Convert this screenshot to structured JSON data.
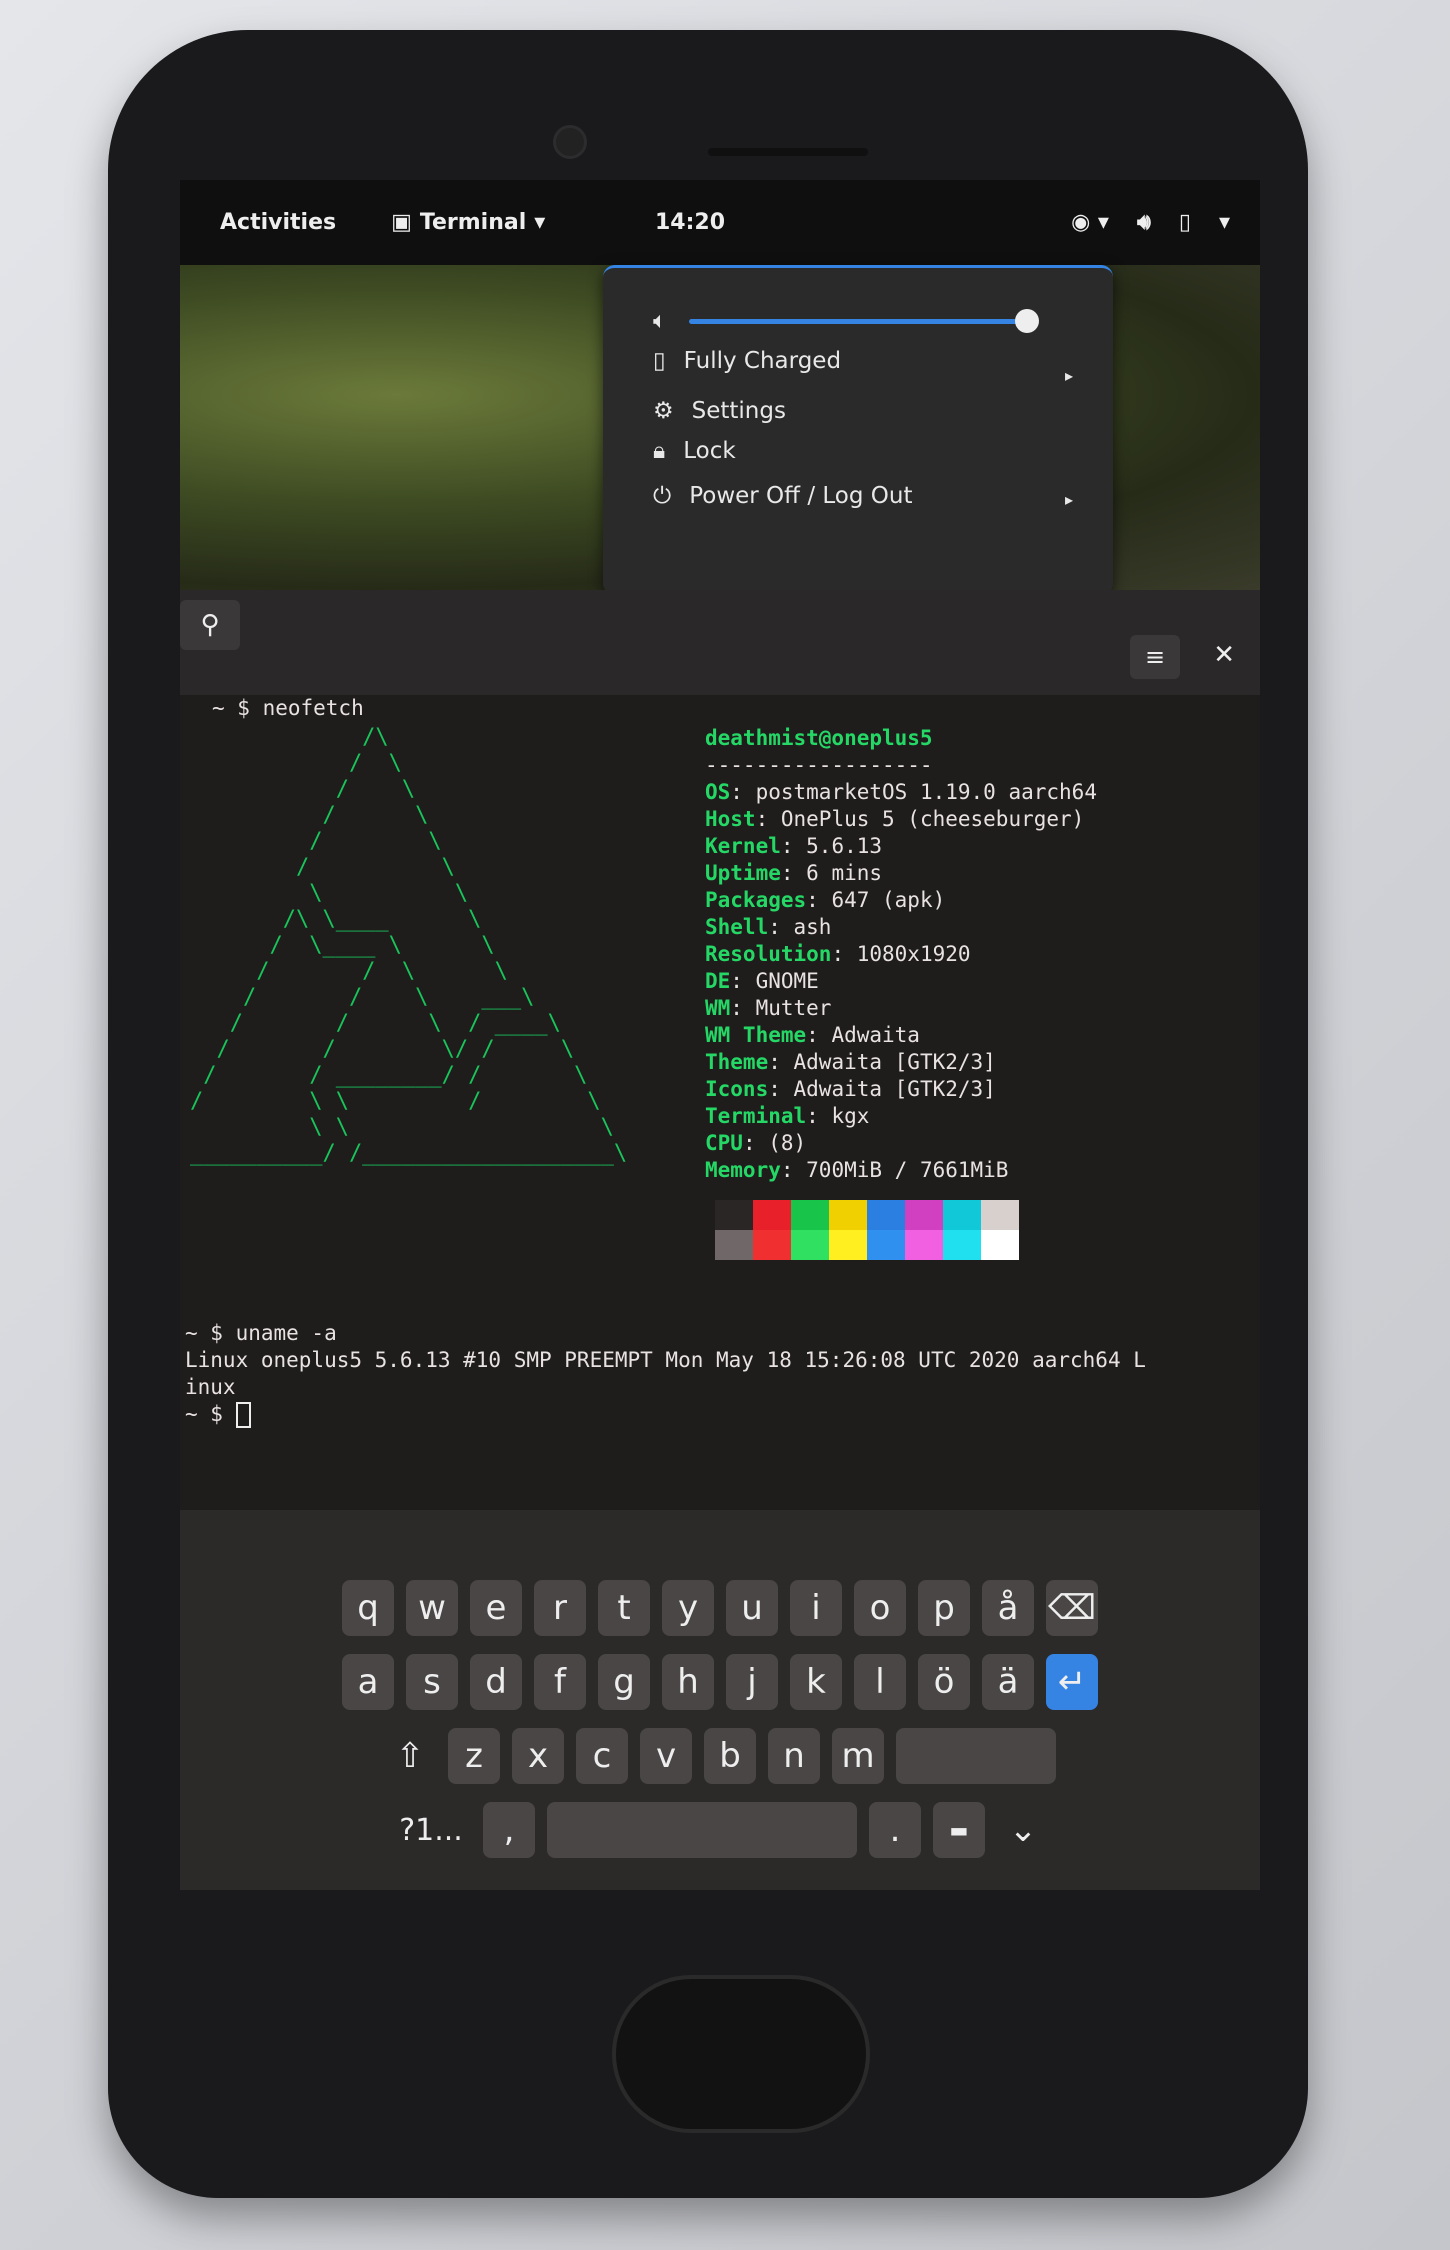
{
  "topbar": {
    "activities": "Activities",
    "app_name": "Terminal",
    "clock": "14:20"
  },
  "system_menu": {
    "battery_label": "Fully Charged",
    "settings_label": "Settings",
    "lock_label": "Lock",
    "power_label": "Power Off / Log Out",
    "volume_level": 0.95,
    "accent": "#3584e4"
  },
  "terminal": {
    "prompt1": "~ $ neofetch",
    "user_host": "deathmist@oneplus5",
    "separator": "------------------",
    "info": [
      {
        "k": "OS",
        "v": "postmarketOS 1.19.0 aarch64"
      },
      {
        "k": "Host",
        "v": "OnePlus 5 (cheeseburger)"
      },
      {
        "k": "Kernel",
        "v": "5.6.13"
      },
      {
        "k": "Uptime",
        "v": "6 mins"
      },
      {
        "k": "Packages",
        "v": "647 (apk)"
      },
      {
        "k": "Shell",
        "v": "ash"
      },
      {
        "k": "Resolution",
        "v": "1080x1920"
      },
      {
        "k": "DE",
        "v": "GNOME"
      },
      {
        "k": "WM",
        "v": "Mutter"
      },
      {
        "k": "WM Theme",
        "v": "Adwaita"
      },
      {
        "k": "Theme",
        "v": "Adwaita [GTK2/3]"
      },
      {
        "k": "Icons",
        "v": "Adwaita [GTK2/3]"
      },
      {
        "k": "Terminal",
        "v": "kgx"
      },
      {
        "k": "CPU",
        "v": "(8)"
      },
      {
        "k": "Memory",
        "v": "700MiB / 7661MiB"
      }
    ],
    "palette": [
      "#2b2626",
      "#e8202a",
      "#19c44a",
      "#f0d000",
      "#2a7fe0",
      "#d040c0",
      "#10c8d8",
      "#d8d0cc",
      "#706868",
      "#f03030",
      "#30e060",
      "#ffee20",
      "#3090f0",
      "#f060e0",
      "#20e0f0",
      "#ffffff"
    ],
    "prompt2": "~ $ uname -a",
    "output": "Linux oneplus5 5.6.13 #10 SMP PREEMPT Mon May 18 15:26:08 UTC 2020 aarch64 L\ninux",
    "prompt3": "~ $ "
  },
  "keyboard": {
    "row1": [
      "q",
      "w",
      "e",
      "r",
      "t",
      "y",
      "u",
      "i",
      "o",
      "p",
      "å"
    ],
    "row2": [
      "a",
      "s",
      "d",
      "f",
      "g",
      "h",
      "j",
      "k",
      "l",
      "ö",
      "ä"
    ],
    "row3": [
      "z",
      "x",
      "c",
      "v",
      "b",
      "n",
      "m"
    ],
    "symbols": "?1...",
    "comma": ",",
    "period": "."
  }
}
